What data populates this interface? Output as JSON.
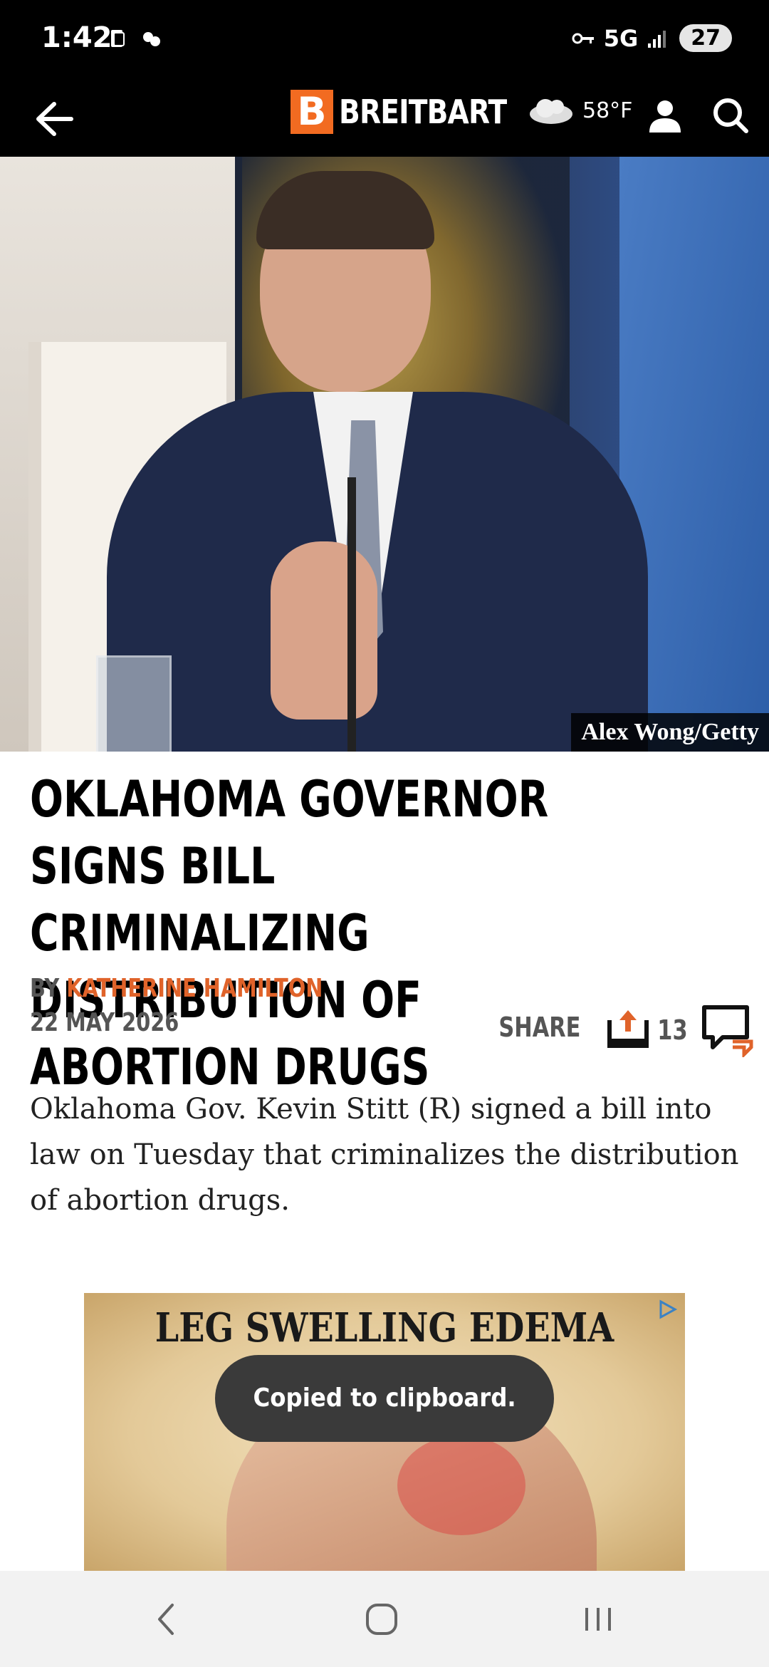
{
  "status_bar": {
    "time": "1:42",
    "network": "5G",
    "battery": "27"
  },
  "header": {
    "logo_letter": "B",
    "logo_text": "BREITBART",
    "temperature": "58°F"
  },
  "hero": {
    "photo_credit": "Alex Wong/Getty"
  },
  "article": {
    "headline": "OKLAHOMA GOVERNOR SIGNS BILL CRIMINALIZING DISTRIBUTION OF ABORTION DRUGS",
    "by_label": "BY",
    "author": "KATHERINE HAMILTON",
    "date": "22 MAY 2026",
    "share_label": "SHARE",
    "comment_count": "13",
    "body": "Oklahoma Gov. Kevin Stitt (R) signed a bill into law on Tuesday that criminalizes the distribution of abortion drugs."
  },
  "ad": {
    "title": "LEG SWELLING EDEMA"
  },
  "toast": {
    "message": "Copied to clipboard."
  },
  "colors": {
    "accent": "#e0632a",
    "logo_orange": "#f26b21",
    "header_bg": "#000000"
  }
}
